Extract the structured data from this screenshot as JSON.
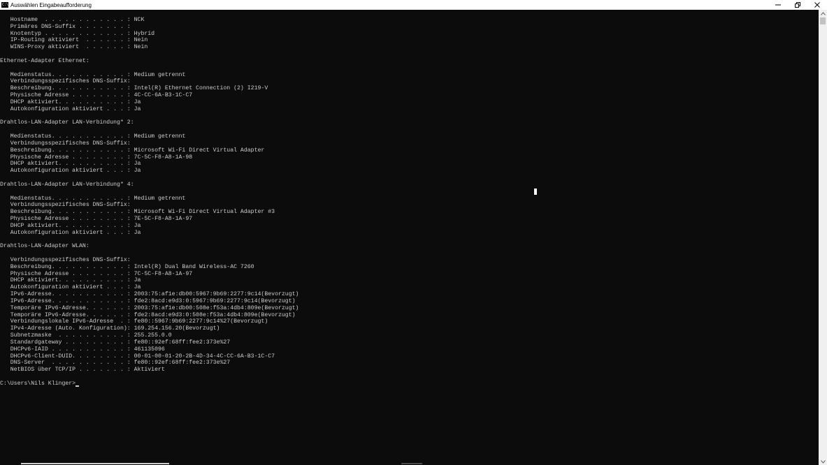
{
  "window": {
    "title": "Auswählen Eingabeaufforderung",
    "icon_label": "C:\\_"
  },
  "caption_buttons": {
    "minimize_icon": "minimize-icon",
    "restore_icon": "restore-icon",
    "close_icon": "close-icon"
  },
  "console": {
    "lines": [
      "   Hostname  . . . . . . . . . . . . : NCK",
      "   Primäres DNS-Suffix . . . . . . . :",
      "   Knotentyp . . . . . . . . . . . . : Hybrid",
      "   IP-Routing aktiviert  . . . . . . : Nein",
      "   WINS-Proxy aktiviert  . . . . . . : Nein",
      "",
      "Ethernet-Adapter Ethernet:",
      "",
      "   Medienstatus. . . . . . . . . . . : Medium getrennt",
      "   Verbindungsspezifisches DNS-Suffix:",
      "   Beschreibung. . . . . . . . . . . : Intel(R) Ethernet Connection (2) I219-V",
      "   Physische Adresse . . . . . . . . : 4C-CC-6A-B3-1C-C7",
      "   DHCP aktiviert. . . . . . . . . . : Ja",
      "   Autokonfiguration aktiviert . . . : Ja",
      "",
      "Drahtlos-LAN-Adapter LAN-Verbindung* 2:",
      "",
      "   Medienstatus. . . . . . . . . . . : Medium getrennt",
      "   Verbindungsspezifisches DNS-Suffix:",
      "   Beschreibung. . . . . . . . . . . : Microsoft Wi-Fi Direct Virtual Adapter",
      "   Physische Adresse . . . . . . . . : 7C-5C-F8-A8-1A-98",
      "   DHCP aktiviert. . . . . . . . . . : Ja",
      "   Autokonfiguration aktiviert . . . : Ja",
      "",
      "Drahtlos-LAN-Adapter LAN-Verbindung* 4:",
      "",
      "   Medienstatus. . . . . . . . . . . : Medium getrennt",
      "   Verbindungsspezifisches DNS-Suffix:",
      "   Beschreibung. . . . . . . . . . . : Microsoft Wi-Fi Direct Virtual Adapter #3",
      "   Physische Adresse . . . . . . . . : 7E-5C-F8-A8-1A-97",
      "   DHCP aktiviert. . . . . . . . . . : Ja",
      "   Autokonfiguration aktiviert . . . : Ja",
      "",
      "Drahtlos-LAN-Adapter WLAN:",
      "",
      "   Verbindungsspezifisches DNS-Suffix:",
      "   Beschreibung. . . . . . . . . . . : Intel(R) Dual Band Wireless-AC 7260",
      "   Physische Adresse . . . . . . . . : 7C-5C-F8-A8-1A-97",
      "   DHCP aktiviert. . . . . . . . . . : Ja",
      "   Autokonfiguration aktiviert . . . : Ja",
      "   IPv6-Adresse. . . . . . . . . . . : 2003:75:af1e:db00:5967:9b69:2277:9c14(Bevorzugt)",
      "   IPv6-Adresse. . . . . . . . . . . : fde2:8acd:e9d3:0:5967:9b69:2277:9c14(Bevorzugt)",
      "   Temporäre IPv6-Adresse. . . . . . : 2003:75:af1e:db00:508e:f53a:4db4:809e(Bevorzugt)",
      "   Temporäre IPv6-Adresse. . . . . . : fde2:8acd:e9d3:0:508e:f53a:4db4:809e(Bevorzugt)",
      "   Verbindungslokale IPv6-Adresse  . : fe80::5967:9b69:2277:9c14%27(Bevorzugt)",
      "   IPv4-Adresse (Auto. Konfiguration): 169.254.156.20(Bevorzugt)",
      "   Subnetzmaske  . . . . . . . . . . : 255.255.0.0",
      "   Standardgateway . . . . . . . . . : fe80::92ef:68ff:fee2:373e%27",
      "   DHCPv6-IAID . . . . . . . . . . . : 461135096",
      "   DHCPv6-Client-DUID. . . . . . . . : 00-01-00-01-20-2B-4D-34-4C-CC-6A-B3-1C-C7",
      "   DNS-Server  . . . . . . . . . . . : fe80::92ef:68ff:fee2:373e%27",
      "   NetBIOS über TCP/IP . . . . . . . : Aktiviert",
      ""
    ],
    "prompt": "C:\\Users\\Nils Klinger>"
  }
}
